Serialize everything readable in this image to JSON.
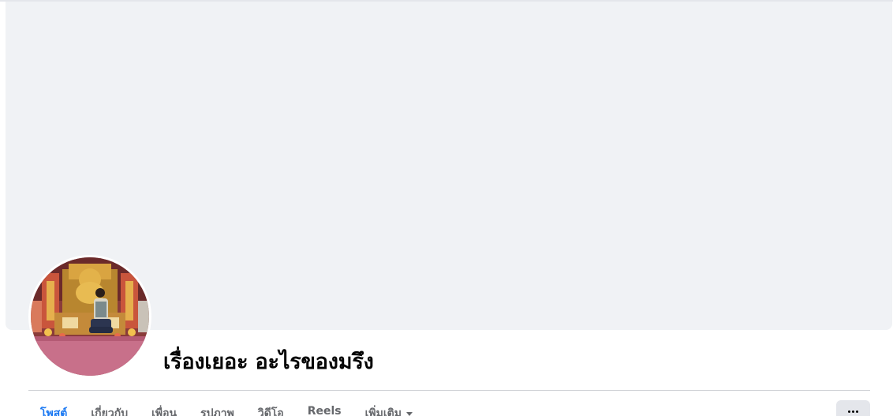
{
  "profile": {
    "name": "เรื่องเยอะ อะไรของมรึง"
  },
  "tabs": [
    {
      "label": "โพสต์",
      "active": true
    },
    {
      "label": "เกี่ยวกับ",
      "active": false
    },
    {
      "label": "เพื่อน",
      "active": false
    },
    {
      "label": "รูปภาพ",
      "active": false
    },
    {
      "label": "วิดีโอ",
      "active": false
    },
    {
      "label": "Reels",
      "active": false
    },
    {
      "label": "เพิ่มเติม",
      "active": false,
      "dropdown": true
    }
  ],
  "icons": {
    "more_tab": "caret-down-icon",
    "options": "more-dots-icon"
  },
  "colors": {
    "accent": "#1877f2",
    "cover_bg": "#f0f2f5",
    "tab_text": "#65676b",
    "button_bg": "#e4e6eb"
  }
}
